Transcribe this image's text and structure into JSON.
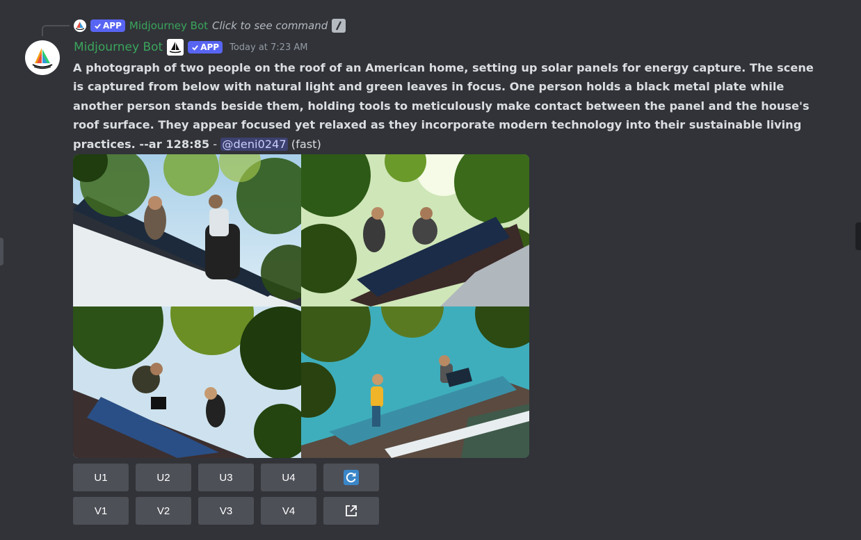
{
  "reply": {
    "badge": "APP",
    "bot_name": "Midjourney Bot",
    "command_hint": "Click to see command"
  },
  "message": {
    "author": "Midjourney Bot",
    "badge": "APP",
    "timestamp": "Today at 7:23 AM",
    "prompt": "A photograph of two people on the roof of an American home, setting up solar panels for energy capture. The scene is captured from below with natural light and green leaves in focus. One person holds a black metal plate while another person stands beside them, holding tools to meticulously make contact between the panel and the house's roof surface. They appear focused yet relaxed as they incorporate modern technology into their sustainable living practices. --ar 128:85",
    "separator": " - ",
    "mention": "@deni0247",
    "speed": " (fast)"
  },
  "image_grid": {
    "alt": [
      "two people installing solar panels on roof, view through leaves",
      "two people on roof with solar panels, sun through leaves",
      "person installing solar panels under trees, view from below",
      "two people on shingle roof with blue solar panels, teal sky"
    ]
  },
  "buttons": {
    "upscale": [
      "U1",
      "U2",
      "U3",
      "U4"
    ],
    "variation": [
      "V1",
      "V2",
      "V3",
      "V4"
    ],
    "reroll_icon": "refresh-icon",
    "web_icon": "external-link-icon"
  },
  "colors": {
    "background": "#313338",
    "bot_name": "#3ba55c",
    "badge": "#5865f2",
    "button": "#4e5058",
    "mention_bg": "#3c4270",
    "refresh_blue": "#3a86c8"
  }
}
